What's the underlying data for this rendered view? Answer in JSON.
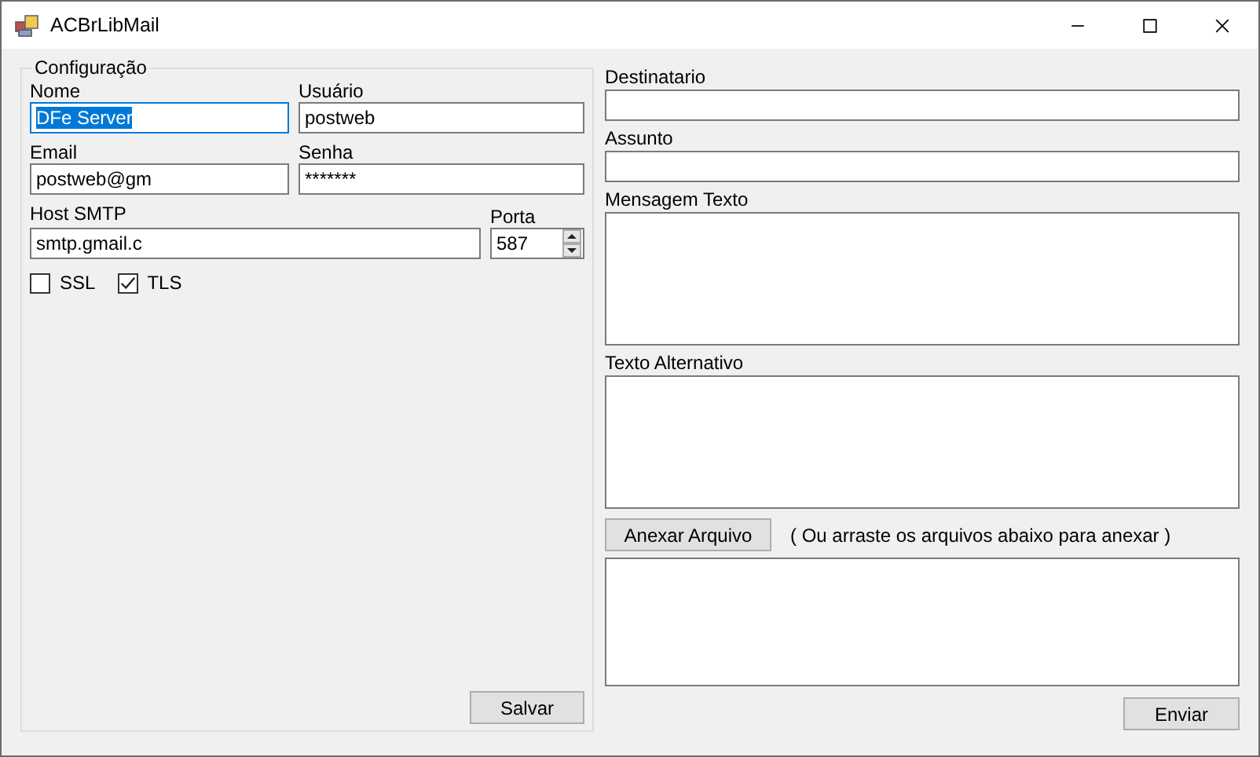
{
  "window": {
    "title": "ACBrLibMail"
  },
  "config": {
    "title": "Configuração",
    "fields": [
      {
        "label": "Nome",
        "value": "DFe Server",
        "focused": true
      },
      {
        "label": "Usuário",
        "value": "postweb",
        "focused": false
      },
      {
        "label": "Email",
        "value": "postweb@gm",
        "focused": false
      },
      {
        "label": "Senha",
        "value": "*******",
        "focused": false
      }
    ],
    "host": {
      "label": "Host SMTP",
      "value": "smtp.gmail.c"
    },
    "port": {
      "label": "Porta",
      "value": "587"
    },
    "checkboxes": [
      {
        "label": "SSL",
        "checked": false
      },
      {
        "label": "TLS",
        "checked": true
      }
    ],
    "save_button": "Salvar"
  },
  "message": {
    "fields": [
      {
        "label": "Destinatario",
        "kind": "line"
      },
      {
        "label": "Assunto",
        "kind": "line"
      },
      {
        "label": "Mensagem Texto",
        "kind": "area"
      },
      {
        "label": "Texto Alternativo",
        "kind": "area"
      }
    ],
    "attach_button": "Anexar Arquivo",
    "attach_hint": "( Ou arraste os arquivos abaixo para anexar )",
    "send_button": "Enviar"
  }
}
